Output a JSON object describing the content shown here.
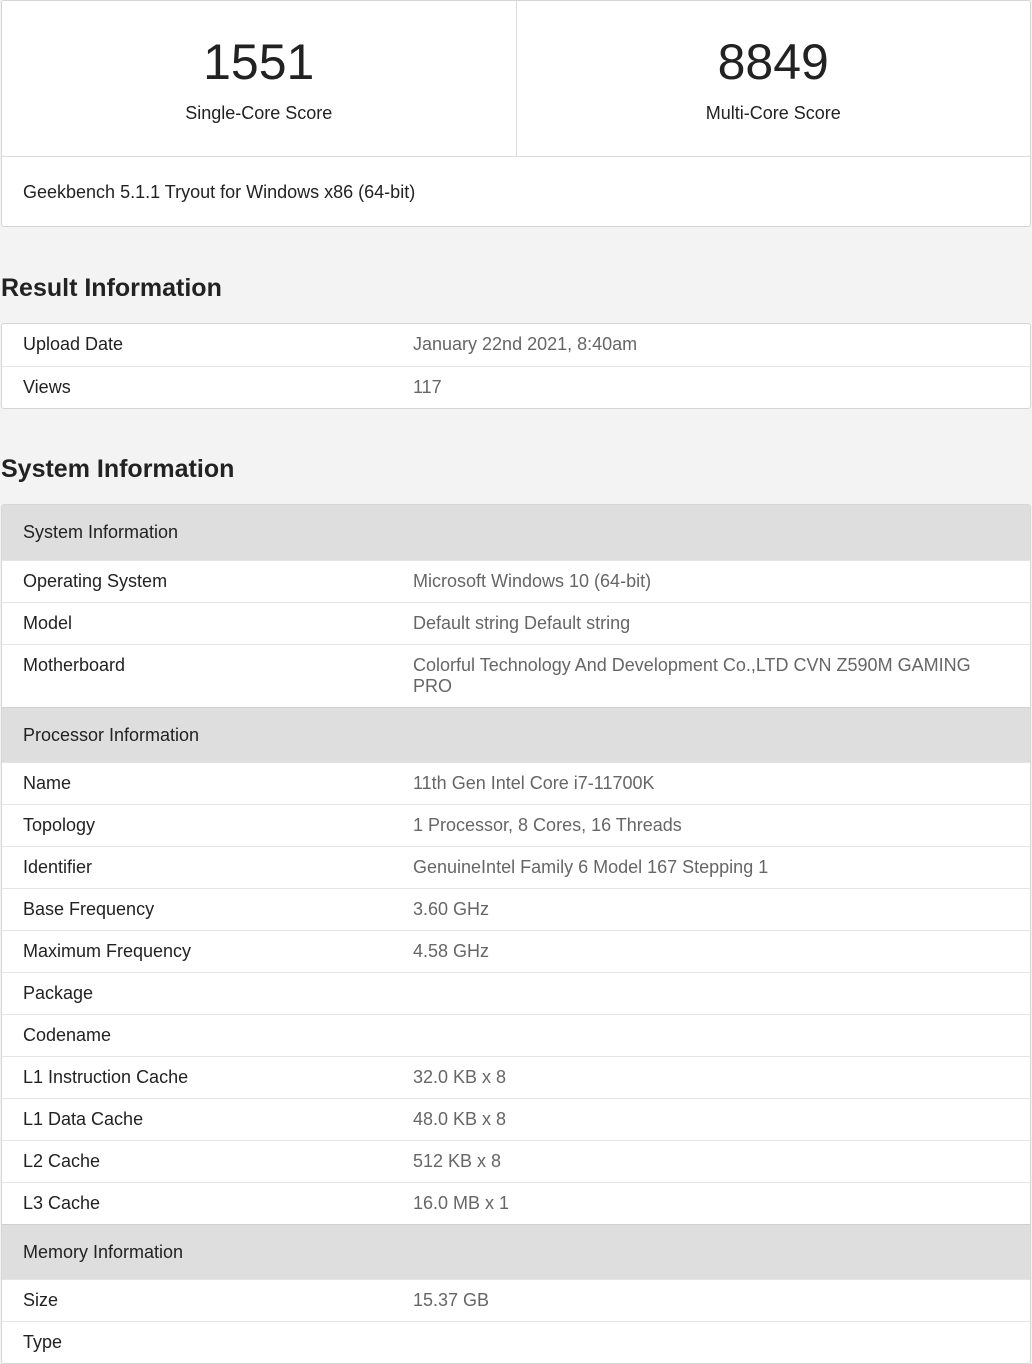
{
  "scores": {
    "single_core": {
      "value": "1551",
      "label": "Single-Core Score"
    },
    "multi_core": {
      "value": "8849",
      "label": "Multi-Core Score"
    },
    "version": "Geekbench 5.1.1 Tryout for Windows x86 (64-bit)"
  },
  "result_info": {
    "title": "Result Information",
    "rows": [
      {
        "key": "Upload Date",
        "value": "January 22nd 2021, 8:40am"
      },
      {
        "key": "Views",
        "value": "117"
      }
    ]
  },
  "system_info": {
    "title": "System Information",
    "groups": [
      {
        "heading": "System Information",
        "rows": [
          {
            "key": "Operating System",
            "value": "Microsoft Windows 10 (64-bit)"
          },
          {
            "key": "Model",
            "value": "Default string Default string"
          },
          {
            "key": "Motherboard",
            "value": "Colorful Technology And Development Co.,LTD CVN Z590M GAMING PRO"
          }
        ]
      },
      {
        "heading": "Processor Information",
        "rows": [
          {
            "key": "Name",
            "value": "11th Gen Intel Core i7-11700K"
          },
          {
            "key": "Topology",
            "value": "1 Processor, 8 Cores, 16 Threads"
          },
          {
            "key": "Identifier",
            "value": "GenuineIntel Family 6 Model 167 Stepping 1"
          },
          {
            "key": "Base Frequency",
            "value": "3.60 GHz"
          },
          {
            "key": "Maximum Frequency",
            "value": "4.58 GHz"
          },
          {
            "key": "Package",
            "value": ""
          },
          {
            "key": "Codename",
            "value": ""
          },
          {
            "key": "L1 Instruction Cache",
            "value": "32.0 KB x 8"
          },
          {
            "key": "L1 Data Cache",
            "value": "48.0 KB x 8"
          },
          {
            "key": "L2 Cache",
            "value": "512 KB x 8"
          },
          {
            "key": "L3 Cache",
            "value": "16.0 MB x 1"
          }
        ]
      },
      {
        "heading": "Memory Information",
        "rows": [
          {
            "key": "Size",
            "value": "15.37 GB"
          },
          {
            "key": "Type",
            "value": ""
          }
        ]
      }
    ]
  }
}
